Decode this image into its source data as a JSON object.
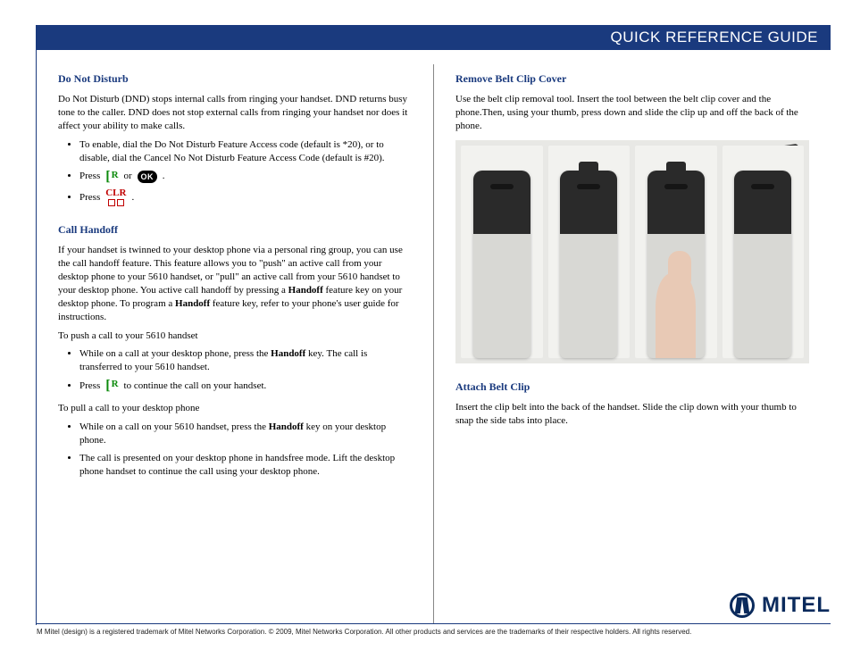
{
  "header": {
    "title": "QUICK REFERENCE GUIDE"
  },
  "left": {
    "dnd": {
      "heading": "Do Not Disturb",
      "intro": "Do Not Disturb (DND) stops internal calls from ringing your handset. DND returns busy tone to the caller. DND does not stop external calls from ringing your handset nor does it affect your ability to make calls.",
      "b1": "To enable, dial the Do Not Disturb Feature Access code (default is *20), or to disable, dial the Cancel No Not Disturb Feature Access Code (default is #20).",
      "b2_pre": "Press",
      "b2_mid": "or",
      "b2_post": ".",
      "b3_pre": "Press",
      "b3_post": "."
    },
    "handoff": {
      "heading": "Call Handoff",
      "intro_a": "If your handset is twinned to your desktop phone via a personal ring group,  you can use the call handoff feature. This feature allows you to \"push\" an active call from your desktop phone to your 5610 handset, or \"pull\" an active call from your 5610 handset to your desktop phone. You active call handoff by pressing a ",
      "intro_b": "Handoff",
      "intro_c": " feature key on your desktop phone. To program a ",
      "intro_d": "Handoff",
      "intro_e": " feature key, refer to your phone's user guide for instructions.",
      "push_label": "To push a call to your 5610 handset",
      "push_b1_a": "While on a call at your desktop phone, press the ",
      "push_b1_b": "Handoff",
      "push_b1_c": " key. The call is transferred to your 5610 handset.",
      "push_b2_pre": "Press",
      "push_b2_post": "to continue the call on your handset.",
      "pull_label": "To pull a call to your desktop phone",
      "pull_b1_a": "While on a call on your 5610 handset, press the ",
      "pull_b1_b": "Handoff",
      "pull_b1_c": " key on your desktop phone.",
      "pull_b2": "The call is presented on your desktop phone in handsfree mode. Lift the desktop phone handset to continue the call using your desktop phone."
    }
  },
  "right": {
    "remove": {
      "heading": "Remove Belt Clip Cover",
      "text": "Use the belt clip removal tool. Insert the tool between the belt clip cover and the phone.Then, using your thumb, press down and slide the clip up and off the back of the phone."
    },
    "attach": {
      "heading": "Attach Belt Clip",
      "text": "Insert the clip belt into the back of the handset. Slide the clip down with your thumb to snap the side tabs into place."
    }
  },
  "logo": {
    "text": "MITEL"
  },
  "footer": {
    "text": "M Mitel (design) is a registered trademark of Mitel Networks Corporation.  © 2009, Mitel Networks Corporation. All other products and services are the trademarks of their respective holders. All rights reserved."
  },
  "icons": {
    "ok": "OK",
    "clr": "CLR",
    "r": "R"
  }
}
